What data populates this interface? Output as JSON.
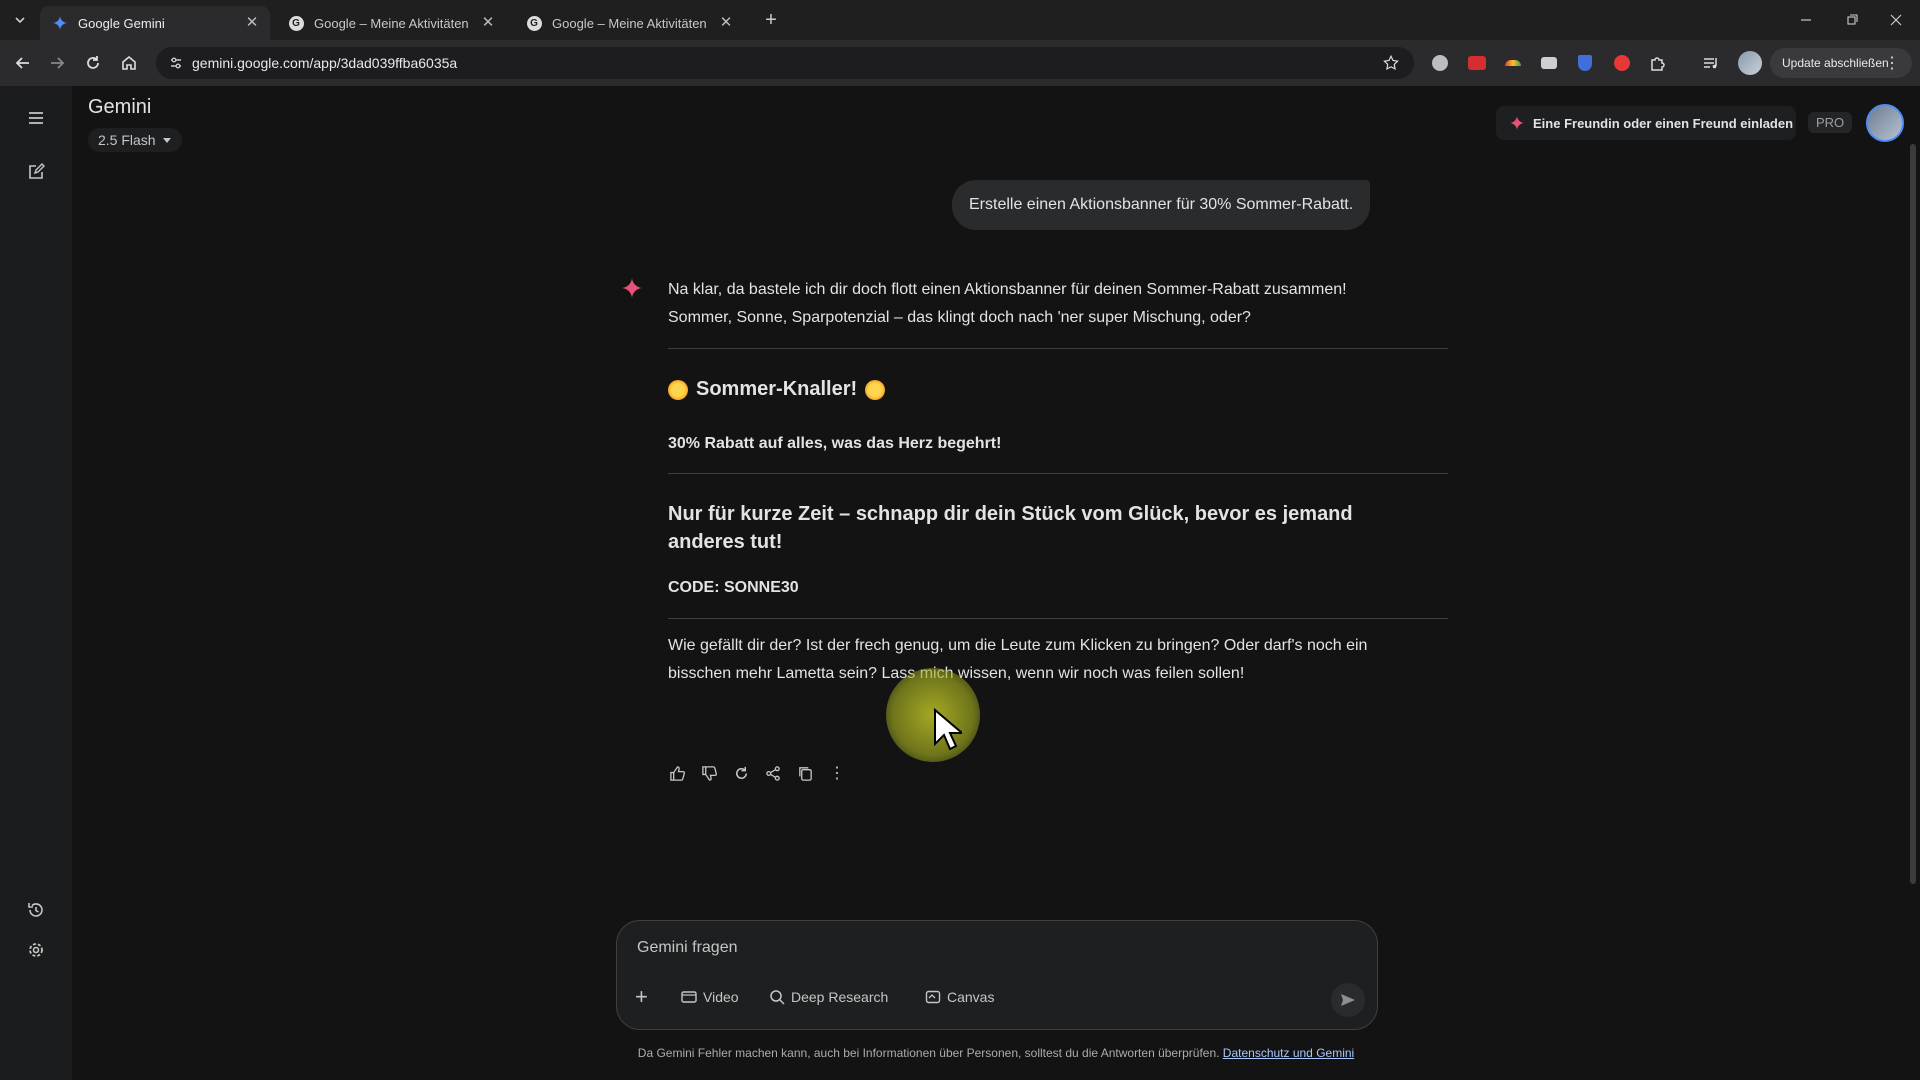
{
  "browser": {
    "tabs": [
      {
        "title": "Google Gemini",
        "active": true,
        "favicon": "gemini-spark-icon"
      },
      {
        "title": "Google – Meine Aktivitäten",
        "active": false,
        "favicon": "google-g-icon"
      },
      {
        "title": "Google – Meine Aktivitäten",
        "active": false,
        "favicon": "google-g-icon"
      }
    ],
    "url": "gemini.google.com/app/3dad039ffba6035a",
    "update_label": "Update abschließen"
  },
  "app": {
    "title": "Gemini",
    "model": "2.5 Flash",
    "invite_label": "Eine Freundin oder einen Freund einladen",
    "pro_badge": "PRO"
  },
  "conversation": {
    "user_message": "Erstelle einen Aktionsbanner für 30% Sommer-Rabatt.",
    "response": {
      "intro": "Na klar, da bastele ich dir doch flott einen Aktionsbanner für deinen Sommer-Rabatt zusammen! Sommer, Sonne, Sparpotenzial – das klingt doch nach 'ner super Mischung, oder?",
      "banner_title": "Sommer-Knaller!",
      "banner_subtitle": "30% Rabatt auf alles, was das Herz begehrt!",
      "headline": "Nur für kurze Zeit – schnapp dir dein Stück vom Glück, bevor es jemand anderes tut!",
      "code": "CODE: SONNE30",
      "outro": "Wie gefällt dir der? Ist der frech genug, um die Leute zum Klicken zu bringen? Oder darf's noch ein bisschen mehr Lametta sein? Lass mich wissen, wenn wir noch was feilen sollen!"
    }
  },
  "input": {
    "placeholder": "Gemini fragen",
    "tools": [
      {
        "label": "Video",
        "icon": "video-icon"
      },
      {
        "label": "Deep Research",
        "icon": "deep-research-icon"
      },
      {
        "label": "Canvas",
        "icon": "canvas-icon"
      }
    ]
  },
  "footer": {
    "disclaimer": "Da Gemini Fehler machen kann, auch bei Informationen über Personen, solltest du die Antworten überprüfen.",
    "link": "Datenschutz und Gemini"
  },
  "colors": {
    "background": "#131314",
    "accent_spark": "#e8527a",
    "link": "#a8c7fa"
  }
}
